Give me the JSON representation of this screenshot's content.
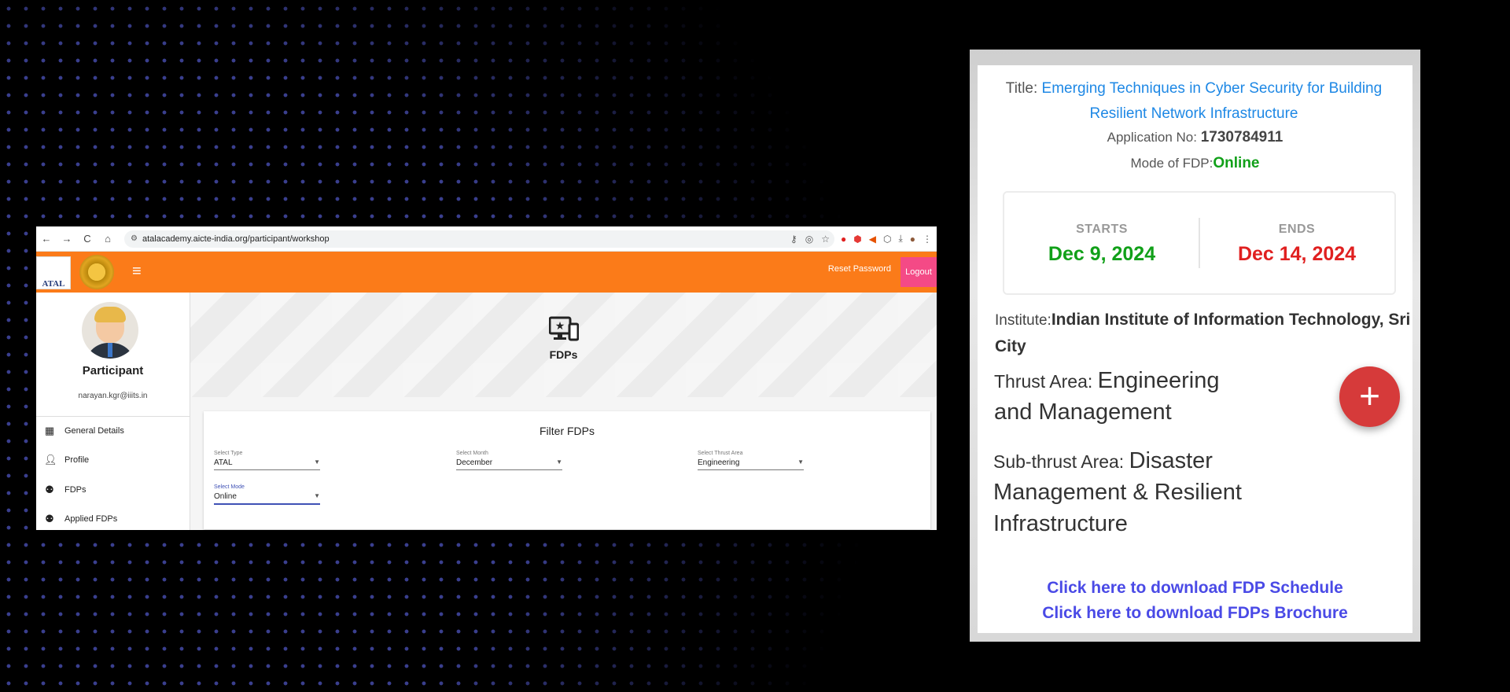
{
  "browser": {
    "url": "atalacademy.aicte-india.org/participant/workshop",
    "nav": {
      "back": "←",
      "forward": "→",
      "reload": "C",
      "home": "⌂"
    }
  },
  "header": {
    "logo_text": "ATAL",
    "reset_password": "Reset Password",
    "logout": "Logout",
    "accent_color": "#fb7b19"
  },
  "sidebar": {
    "role": "Participant",
    "email": "narayan.kgr@iiits.in",
    "items": [
      {
        "label": "General Details",
        "icon": "dashboard-icon"
      },
      {
        "label": "Profile",
        "icon": "person-icon"
      },
      {
        "label": "FDPs",
        "icon": "workshop-icon"
      },
      {
        "label": "Applied FDPs",
        "icon": "workshop-icon"
      }
    ]
  },
  "hero": {
    "title": "FDPs",
    "icon": "monitor-star-icon"
  },
  "filter": {
    "title": "Filter FDPs",
    "type": {
      "label": "Select Type",
      "value": "ATAL"
    },
    "month": {
      "label": "Select Month",
      "value": "December"
    },
    "thrust": {
      "label": "Select Thrust Area",
      "value": "Engineering"
    },
    "mode": {
      "label": "Select Mode",
      "value": "Online"
    }
  },
  "fdp_card": {
    "title_label": "Title:",
    "title": "Emerging Techniques in Cyber Security for Building Resilient Network Infrastructure",
    "application_label": "Application No:",
    "application_no": "1730784911",
    "mode_label": "Mode of FDP:",
    "mode": "Online",
    "starts_label": "STARTS",
    "starts": "Dec 9, 2024",
    "ends_label": "ENDS",
    "ends": "Dec 14, 2024",
    "institute_label": "Institute:",
    "institute": "Indian Institute of Information Technology, Sri City",
    "thrust_label": "Thrust Area:",
    "thrust": "Engineering and Management",
    "subthrust_label": "Sub-thrust Area:",
    "subthrust": "Disaster Management & Resilient Infrastructure",
    "schedule_link": "Click here to download FDP Schedule",
    "brochure_link": "Click here to download FDPs Brochure",
    "fab": "+",
    "colors": {
      "title": "#1e88e5",
      "mode": "#11a019",
      "start": "#11a019",
      "end": "#e02020",
      "link": "#4a4ae6",
      "fab": "#d63a3a"
    }
  }
}
